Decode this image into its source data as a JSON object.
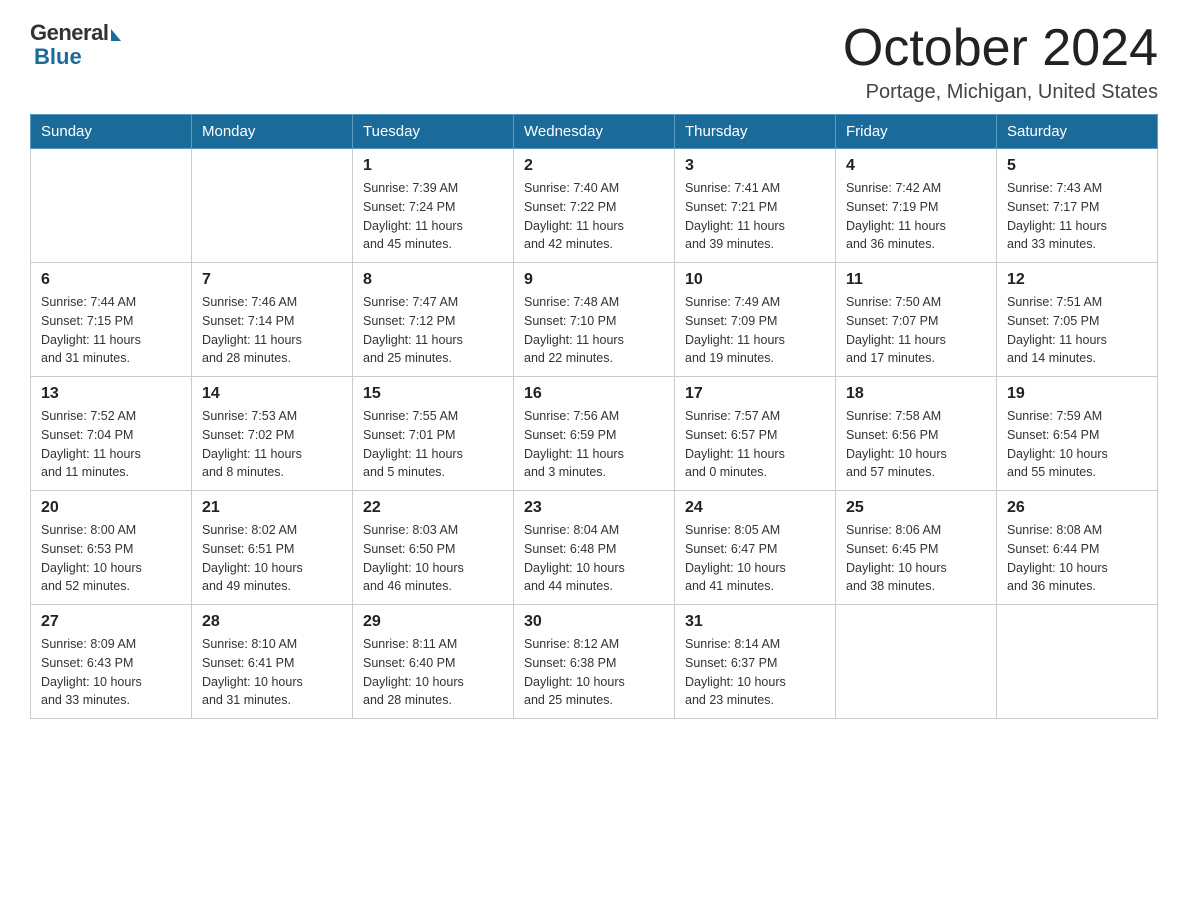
{
  "header": {
    "logo_general": "General",
    "logo_blue": "Blue",
    "month_title": "October 2024",
    "location": "Portage, Michigan, United States"
  },
  "weekdays": [
    "Sunday",
    "Monday",
    "Tuesday",
    "Wednesday",
    "Thursday",
    "Friday",
    "Saturday"
  ],
  "weeks": [
    [
      {
        "day": "",
        "info": ""
      },
      {
        "day": "",
        "info": ""
      },
      {
        "day": "1",
        "info": "Sunrise: 7:39 AM\nSunset: 7:24 PM\nDaylight: 11 hours\nand 45 minutes."
      },
      {
        "day": "2",
        "info": "Sunrise: 7:40 AM\nSunset: 7:22 PM\nDaylight: 11 hours\nand 42 minutes."
      },
      {
        "day": "3",
        "info": "Sunrise: 7:41 AM\nSunset: 7:21 PM\nDaylight: 11 hours\nand 39 minutes."
      },
      {
        "day": "4",
        "info": "Sunrise: 7:42 AM\nSunset: 7:19 PM\nDaylight: 11 hours\nand 36 minutes."
      },
      {
        "day": "5",
        "info": "Sunrise: 7:43 AM\nSunset: 7:17 PM\nDaylight: 11 hours\nand 33 minutes."
      }
    ],
    [
      {
        "day": "6",
        "info": "Sunrise: 7:44 AM\nSunset: 7:15 PM\nDaylight: 11 hours\nand 31 minutes."
      },
      {
        "day": "7",
        "info": "Sunrise: 7:46 AM\nSunset: 7:14 PM\nDaylight: 11 hours\nand 28 minutes."
      },
      {
        "day": "8",
        "info": "Sunrise: 7:47 AM\nSunset: 7:12 PM\nDaylight: 11 hours\nand 25 minutes."
      },
      {
        "day": "9",
        "info": "Sunrise: 7:48 AM\nSunset: 7:10 PM\nDaylight: 11 hours\nand 22 minutes."
      },
      {
        "day": "10",
        "info": "Sunrise: 7:49 AM\nSunset: 7:09 PM\nDaylight: 11 hours\nand 19 minutes."
      },
      {
        "day": "11",
        "info": "Sunrise: 7:50 AM\nSunset: 7:07 PM\nDaylight: 11 hours\nand 17 minutes."
      },
      {
        "day": "12",
        "info": "Sunrise: 7:51 AM\nSunset: 7:05 PM\nDaylight: 11 hours\nand 14 minutes."
      }
    ],
    [
      {
        "day": "13",
        "info": "Sunrise: 7:52 AM\nSunset: 7:04 PM\nDaylight: 11 hours\nand 11 minutes."
      },
      {
        "day": "14",
        "info": "Sunrise: 7:53 AM\nSunset: 7:02 PM\nDaylight: 11 hours\nand 8 minutes."
      },
      {
        "day": "15",
        "info": "Sunrise: 7:55 AM\nSunset: 7:01 PM\nDaylight: 11 hours\nand 5 minutes."
      },
      {
        "day": "16",
        "info": "Sunrise: 7:56 AM\nSunset: 6:59 PM\nDaylight: 11 hours\nand 3 minutes."
      },
      {
        "day": "17",
        "info": "Sunrise: 7:57 AM\nSunset: 6:57 PM\nDaylight: 11 hours\nand 0 minutes."
      },
      {
        "day": "18",
        "info": "Sunrise: 7:58 AM\nSunset: 6:56 PM\nDaylight: 10 hours\nand 57 minutes."
      },
      {
        "day": "19",
        "info": "Sunrise: 7:59 AM\nSunset: 6:54 PM\nDaylight: 10 hours\nand 55 minutes."
      }
    ],
    [
      {
        "day": "20",
        "info": "Sunrise: 8:00 AM\nSunset: 6:53 PM\nDaylight: 10 hours\nand 52 minutes."
      },
      {
        "day": "21",
        "info": "Sunrise: 8:02 AM\nSunset: 6:51 PM\nDaylight: 10 hours\nand 49 minutes."
      },
      {
        "day": "22",
        "info": "Sunrise: 8:03 AM\nSunset: 6:50 PM\nDaylight: 10 hours\nand 46 minutes."
      },
      {
        "day": "23",
        "info": "Sunrise: 8:04 AM\nSunset: 6:48 PM\nDaylight: 10 hours\nand 44 minutes."
      },
      {
        "day": "24",
        "info": "Sunrise: 8:05 AM\nSunset: 6:47 PM\nDaylight: 10 hours\nand 41 minutes."
      },
      {
        "day": "25",
        "info": "Sunrise: 8:06 AM\nSunset: 6:45 PM\nDaylight: 10 hours\nand 38 minutes."
      },
      {
        "day": "26",
        "info": "Sunrise: 8:08 AM\nSunset: 6:44 PM\nDaylight: 10 hours\nand 36 minutes."
      }
    ],
    [
      {
        "day": "27",
        "info": "Sunrise: 8:09 AM\nSunset: 6:43 PM\nDaylight: 10 hours\nand 33 minutes."
      },
      {
        "day": "28",
        "info": "Sunrise: 8:10 AM\nSunset: 6:41 PM\nDaylight: 10 hours\nand 31 minutes."
      },
      {
        "day": "29",
        "info": "Sunrise: 8:11 AM\nSunset: 6:40 PM\nDaylight: 10 hours\nand 28 minutes."
      },
      {
        "day": "30",
        "info": "Sunrise: 8:12 AM\nSunset: 6:38 PM\nDaylight: 10 hours\nand 25 minutes."
      },
      {
        "day": "31",
        "info": "Sunrise: 8:14 AM\nSunset: 6:37 PM\nDaylight: 10 hours\nand 23 minutes."
      },
      {
        "day": "",
        "info": ""
      },
      {
        "day": "",
        "info": ""
      }
    ]
  ]
}
